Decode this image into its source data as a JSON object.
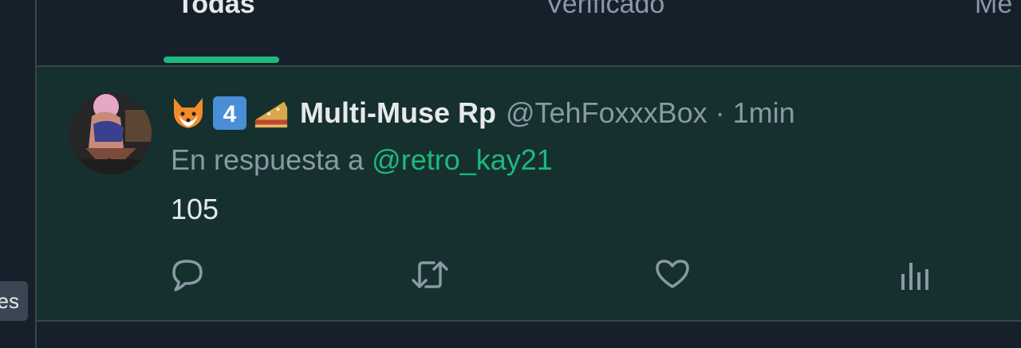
{
  "tabs": [
    {
      "label": "Todas",
      "active": true
    },
    {
      "label": "Verificado",
      "active": false
    },
    {
      "label": "Me",
      "active": false
    }
  ],
  "side_chip": {
    "label": "es"
  },
  "post": {
    "avatar": "user-avatar-image",
    "badges": [
      "fox-emoji",
      "keycap-4-emoji",
      "pie-emoji"
    ],
    "display_name": "Multi-Muse Rp",
    "handle_time": "@TehFoxxxBox · 1min",
    "reply_prefix": "En respuesta a",
    "reply_mention": "@retro_kay21",
    "text": "105"
  },
  "actions": [
    "reply-icon",
    "retweet-icon",
    "like-icon",
    "analytics-icon"
  ],
  "colors": {
    "background": "#15202b",
    "post_highlight": "#15302f",
    "accent": "#1db87e",
    "secondary_text": "#8b98a5",
    "primary_text": "#e7e9ea"
  }
}
